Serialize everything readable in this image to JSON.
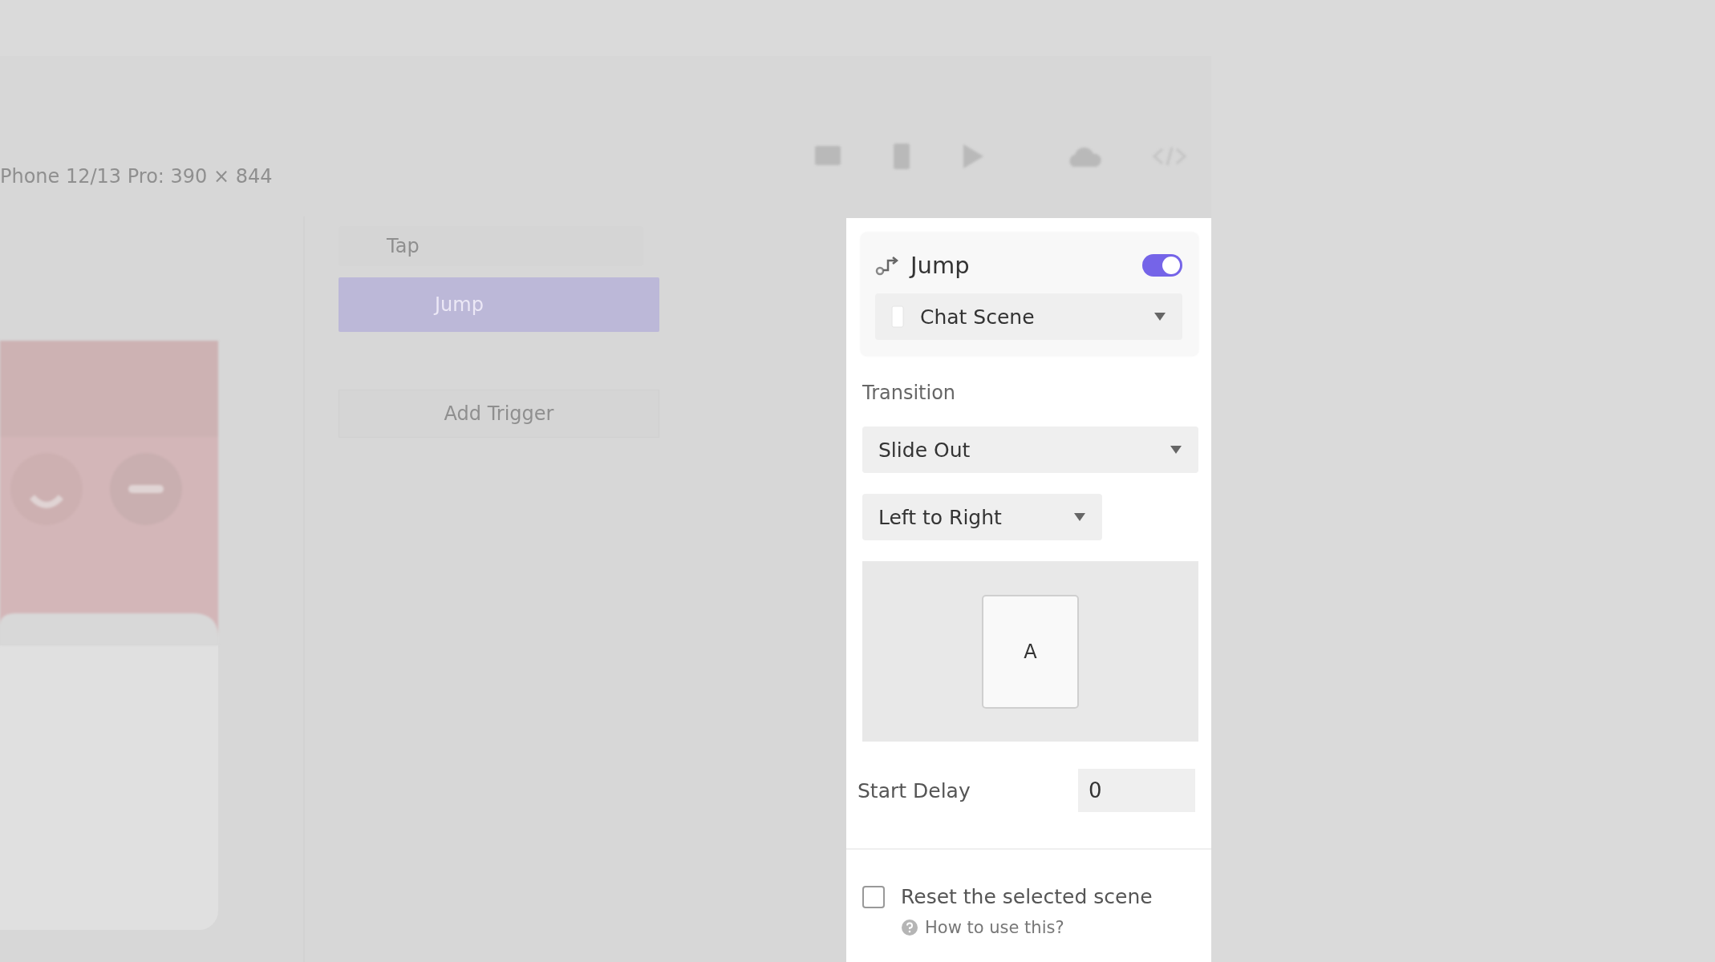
{
  "background": {
    "device_label": "Phone 12/13 Pro: 390 × 844",
    "trigger": "Tap",
    "action": "Jump",
    "add_button": "Add Trigger"
  },
  "panel": {
    "title": "Jump",
    "enabled": true,
    "scene": "Chat Scene",
    "transition_label": "Transition",
    "transition": "Slide Out",
    "direction": "Left to Right",
    "preview_letter": "A",
    "start_delay_label": "Start Delay",
    "start_delay": "0",
    "reset": {
      "label": "Reset the selected scene",
      "checked": false
    },
    "help_link": "How to use this?"
  }
}
